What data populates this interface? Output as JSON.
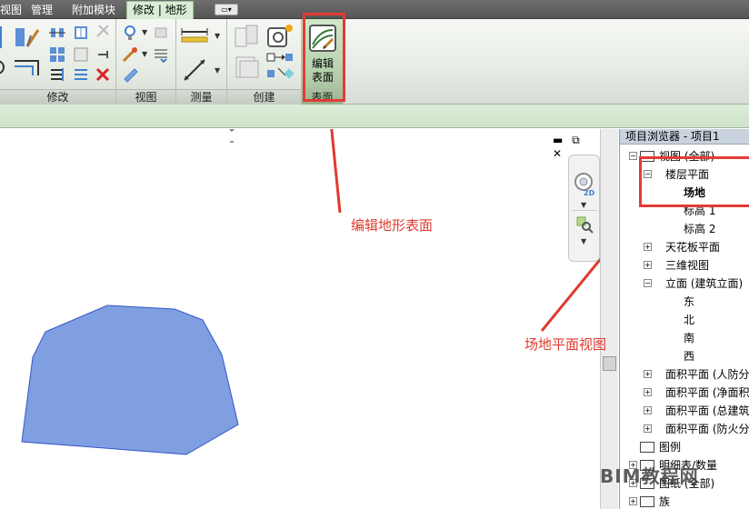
{
  "tabs": [
    {
      "label": "视图",
      "active": false
    },
    {
      "label": "管理",
      "active": false
    },
    {
      "label": "附加模块",
      "active": false
    },
    {
      "label": "修改 | 地形",
      "active": true
    }
  ],
  "quick_access_dropdown": "▭▾",
  "ribbon": {
    "panels": {
      "modify": "修改",
      "view": "视图",
      "measure": "测量",
      "create": "创建",
      "surface": "表面"
    },
    "edit_surface_label": "编辑\n表面"
  },
  "canvas": {
    "window_controls": "▬ ⧉ ✕",
    "nav_label_2d": "2D",
    "toposurface_color": "#7f9fe0",
    "toposurface_stroke": "#3456c8"
  },
  "browser": {
    "title": "项目浏览器 - 项目1",
    "tree": [
      {
        "label": "视图 (全部)",
        "expander": "−",
        "level": 0,
        "icon": "views-icon"
      },
      {
        "label": "楼层平面",
        "expander": "−",
        "level": 1
      },
      {
        "label": "场地",
        "level": 2,
        "bold": true
      },
      {
        "label": "标高 1",
        "level": 2
      },
      {
        "label": "标高 2",
        "level": 2
      },
      {
        "label": "天花板平面",
        "expander": "+",
        "level": 1
      },
      {
        "label": "三维视图",
        "expander": "+",
        "level": 1
      },
      {
        "label": "立面 (建筑立面)",
        "expander": "−",
        "level": 1
      },
      {
        "label": "东",
        "level": 2
      },
      {
        "label": "北",
        "level": 2
      },
      {
        "label": "南",
        "level": 2
      },
      {
        "label": "西",
        "level": 2
      },
      {
        "label": "面积平面 (人防分",
        "expander": "+",
        "level": 1
      },
      {
        "label": "面积平面 (净面积",
        "expander": "+",
        "level": 1
      },
      {
        "label": "面积平面 (总建筑",
        "expander": "+",
        "level": 1
      },
      {
        "label": "面积平面 (防火分",
        "expander": "+",
        "level": 1
      },
      {
        "label": "图例",
        "level": 0,
        "icon": "legend-icon"
      },
      {
        "label": "明细表/数量",
        "expander": "+",
        "level": 0,
        "icon": "schedule-icon"
      },
      {
        "label": "图纸 (全部)",
        "expander": "+",
        "level": 0,
        "icon": "sheet-icon"
      },
      {
        "label": "族",
        "expander": "+",
        "level": 0,
        "icon": "family-icon"
      }
    ]
  },
  "annotations": {
    "edit_surface": "编辑地形表面",
    "site_plan": "场地平面视图",
    "color": "#e03a2f"
  },
  "watermark": "BIM教程网"
}
